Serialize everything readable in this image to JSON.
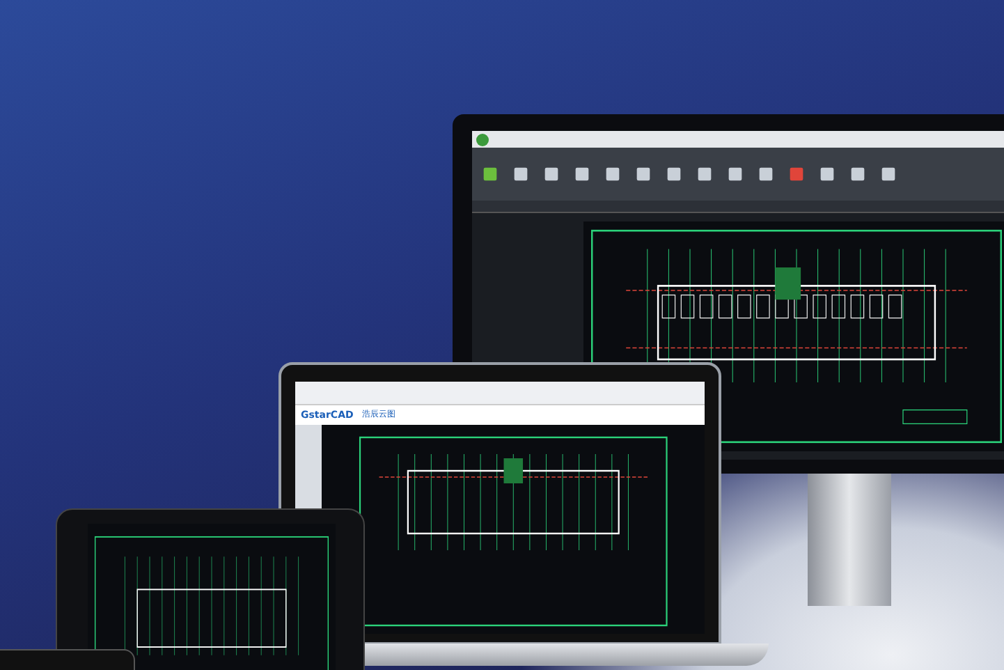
{
  "laptop": {
    "logo": "GstarCAD",
    "product": "浩辰云图"
  }
}
